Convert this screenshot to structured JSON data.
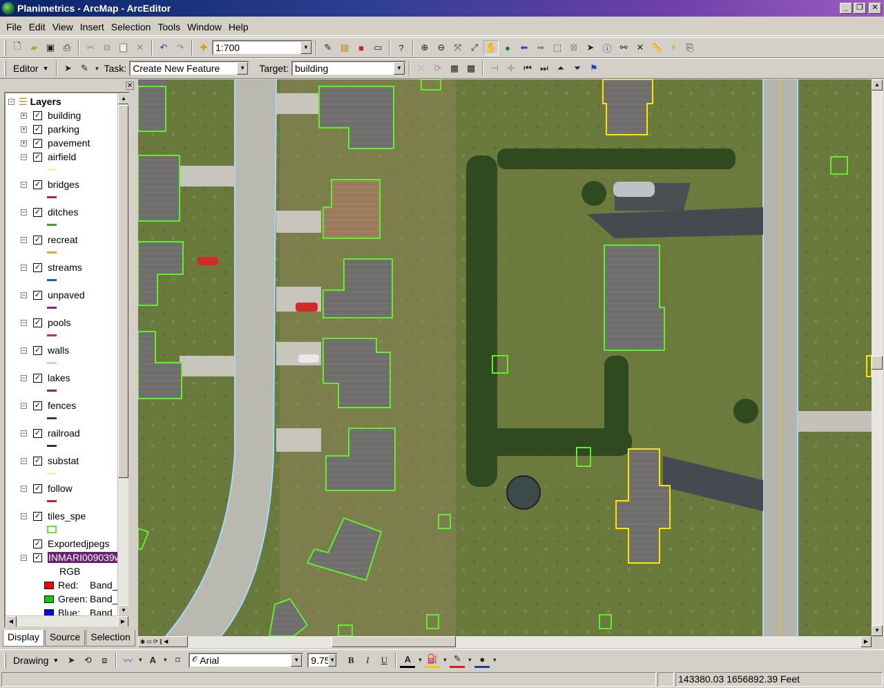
{
  "window": {
    "title": "Planimetrics - ArcMap - ArcEditor"
  },
  "menu": [
    "File",
    "Edit",
    "View",
    "Insert",
    "Selection",
    "Tools",
    "Window",
    "Help"
  ],
  "standard_toolbar": {
    "scale": "1:700"
  },
  "editor_toolbar": {
    "editor_label": "Editor",
    "task_label": "Task:",
    "task_value": "Create New Feature",
    "target_label": "Target:",
    "target_value": "building"
  },
  "toc": {
    "root": "Layers",
    "layers": [
      {
        "name": "building",
        "expander": "+",
        "checked": true,
        "symbol": null
      },
      {
        "name": "parking",
        "expander": "+",
        "checked": true,
        "symbol": null
      },
      {
        "name": "pavement",
        "expander": "+",
        "checked": true,
        "symbol": null
      },
      {
        "name": "airfield",
        "expander": "−",
        "checked": true,
        "symbol": "#f4f0c0"
      },
      {
        "name": "bridges",
        "expander": "−",
        "checked": true,
        "symbol": "#b0207a"
      },
      {
        "name": "ditches",
        "expander": "−",
        "checked": true,
        "symbol": "#4a9a2a"
      },
      {
        "name": "recreat",
        "expander": "−",
        "checked": true,
        "symbol": "#e0b020"
      },
      {
        "name": "streams",
        "expander": "−",
        "checked": true,
        "symbol": "#2060a0"
      },
      {
        "name": "unpaved",
        "expander": "−",
        "checked": true,
        "symbol": "#902080"
      },
      {
        "name": "pools",
        "expander": "−",
        "checked": true,
        "symbol": "#d0208a"
      },
      {
        "name": "walls",
        "expander": "−",
        "checked": true,
        "symbol": "#f0c0e0"
      },
      {
        "name": "lakes",
        "expander": "−",
        "checked": true,
        "symbol": "#8a2090"
      },
      {
        "name": "fences",
        "expander": "−",
        "checked": true,
        "symbol": "#204060"
      },
      {
        "name": "railroad",
        "expander": "−",
        "checked": true,
        "symbol": "#333333"
      },
      {
        "name": "substat",
        "expander": "−",
        "checked": true,
        "symbol": "#f4f0c0"
      },
      {
        "name": "follow",
        "expander": "−",
        "checked": true,
        "symbol": "#d02020"
      },
      {
        "name": "tiles_spe",
        "expander": "−",
        "checked": true,
        "symbol": "box"
      },
      {
        "name": "Exportedjpegs",
        "expander": "",
        "checked": true,
        "symbol": null
      },
      {
        "name": "INMARI009039w",
        "expander": "−",
        "checked": true,
        "symbol": null,
        "selected": true
      }
    ],
    "rgb_label": "RGB",
    "bands": [
      {
        "color": "#ff0000",
        "label": "Red:",
        "value": "Band_"
      },
      {
        "color": "#00d000",
        "label": "Green:",
        "value": "Band_"
      },
      {
        "color": "#0000ff",
        "label": "Blue:",
        "value": "Band_"
      }
    ],
    "tabs": [
      "Display",
      "Source",
      "Selection"
    ]
  },
  "drawing_toolbar": {
    "drawing_label": "Drawing",
    "font": "Arial",
    "size": "9.75",
    "bold": "B",
    "italic": "I",
    "underline": "U",
    "font_color_glyph": "A"
  },
  "status": {
    "coords": "143380.03  1656892.39 Feet"
  },
  "colors": {
    "building_outline": "#5ef02a",
    "selected_outline": "#ffe600",
    "title_start": "#0a246a",
    "title_end": "#9b5cc4"
  }
}
